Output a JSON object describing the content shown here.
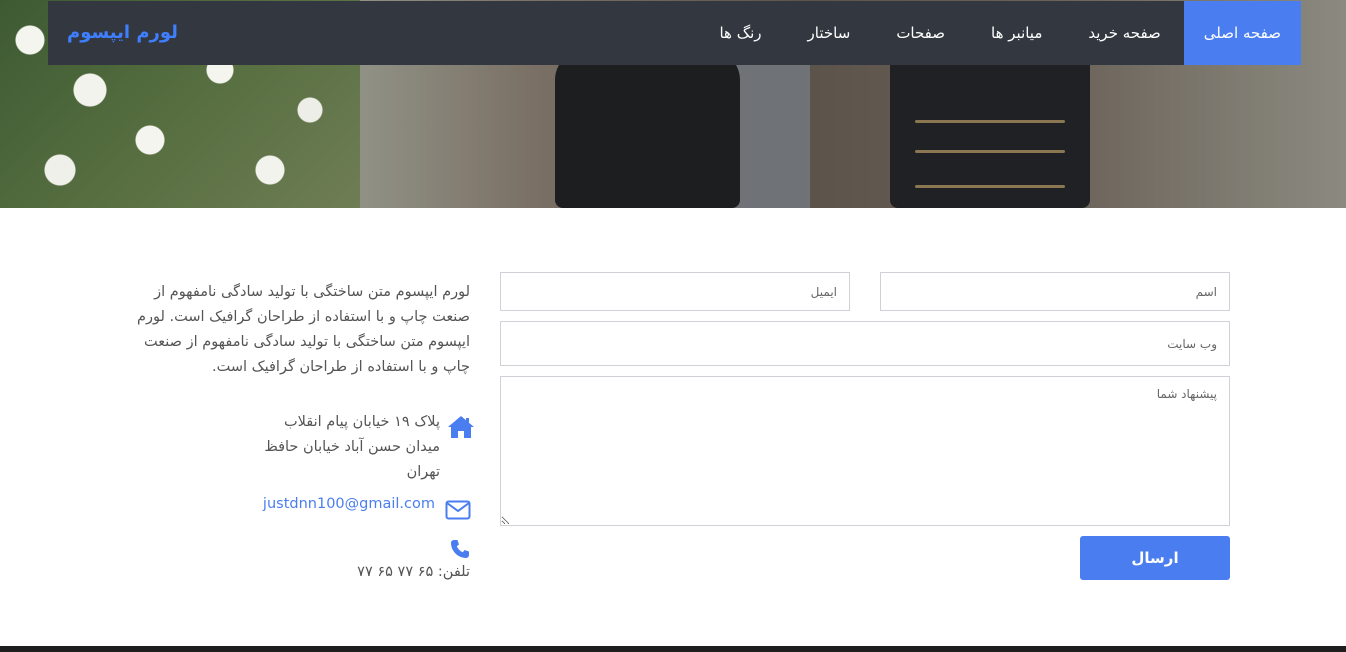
{
  "brand": {
    "name": "لورم ایپسوم"
  },
  "nav": {
    "items": [
      {
        "label": "صفحه اصلی",
        "active": true
      },
      {
        "label": "صفحه خرید",
        "active": false
      },
      {
        "label": "میانبر ها",
        "active": false
      },
      {
        "label": "صفحات",
        "active": false
      },
      {
        "label": "ساختار",
        "active": false
      },
      {
        "label": "رنگ ها",
        "active": false
      }
    ]
  },
  "form": {
    "name_placeholder": "اسم",
    "email_placeholder": "ایمیل",
    "website_placeholder": "وب سایت",
    "message_placeholder": "پیشنهاد شما",
    "submit_label": "ارسال"
  },
  "info": {
    "about": "لورم ایپسوم متن ساختگی با تولید سادگی نامفهوم از صنعت چاپ و با استفاده از طراحان گرافیک است. لورم ایپسوم متن ساختگی با تولید سادگی نامفهوم از صنعت چاپ و با استفاده از طراحان گرافیک است.",
    "address_line1": "پلاک ۱۹ خیابان پیام انقلاب",
    "address_line2": "میدان حسن آباد خیابان حافظ",
    "address_line3": "تهران",
    "email": "justdnn100@gmail.com",
    "phone": "تلفن: ۶۵ ۷۷ ۶۵ ۷۷"
  },
  "colors": {
    "accent": "#4a7ef0",
    "navbar": "#333740",
    "brand": "#3f7fff"
  },
  "icons": {
    "address": "home-icon",
    "email": "envelope-icon",
    "phone": "phone-icon"
  }
}
